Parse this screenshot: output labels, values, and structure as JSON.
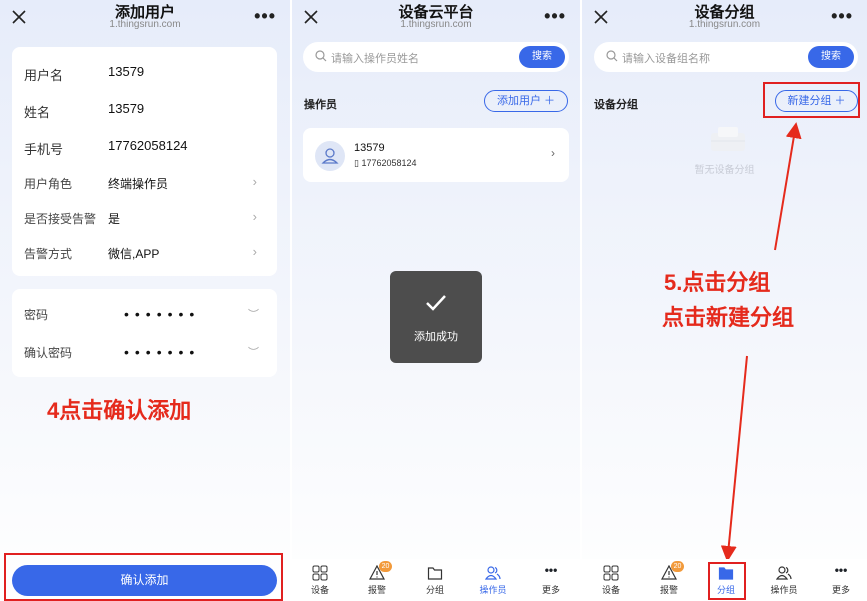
{
  "panel1": {
    "title": "添加用户",
    "url": "1.thingsrun.com",
    "fields": [
      {
        "label": "用户名",
        "value": "13579"
      },
      {
        "label": "姓名",
        "value": "13579"
      },
      {
        "label": "手机号",
        "value": "17762058124"
      },
      {
        "label": "用户角色",
        "value": "终端操作员"
      },
      {
        "label": "是否接受告警",
        "value": "是"
      },
      {
        "label": "告警方式",
        "value": "微信,APP"
      }
    ],
    "password_label": "密码",
    "password_value": "•••••••",
    "confirm_password_label": "确认密码",
    "confirm_password_value": "•••••••",
    "annotation": "4点击确认添加",
    "confirm_button": "确认添加"
  },
  "panel2": {
    "title": "设备云平台",
    "url": "1.thingsrun.com",
    "search_placeholder": "请输入操作员姓名",
    "search_button": "搜索",
    "section_title": "操作员",
    "add_user_button": "添加用户 ＋",
    "user": {
      "name": "13579",
      "phone": "17762058124"
    },
    "toast": "添加成功"
  },
  "panel3": {
    "title": "设备分组",
    "url": "1.thingsrun.com",
    "search_placeholder": "请输入设备组名称",
    "search_button": "搜索",
    "section_title": "设备分组",
    "new_group_button": "新建分组 ＋",
    "empty_text": "暂无设备分组",
    "annotation_line1": "5.点击分组",
    "annotation_line2": "点击新建分组"
  },
  "tabbar": {
    "items": [
      {
        "label": "设备",
        "icon": "device-grid-icon"
      },
      {
        "label": "报警",
        "icon": "alarm-warning-icon",
        "badge": "20"
      },
      {
        "label": "分组",
        "icon": "folder-icon"
      },
      {
        "label": "操作员",
        "icon": "operator-users-icon"
      },
      {
        "label": "更多",
        "icon": "more-dots-icon"
      }
    ]
  },
  "colors": {
    "accent": "#3868e8",
    "annotation_red": "#e52a1c",
    "badge": "#f29a3b"
  }
}
